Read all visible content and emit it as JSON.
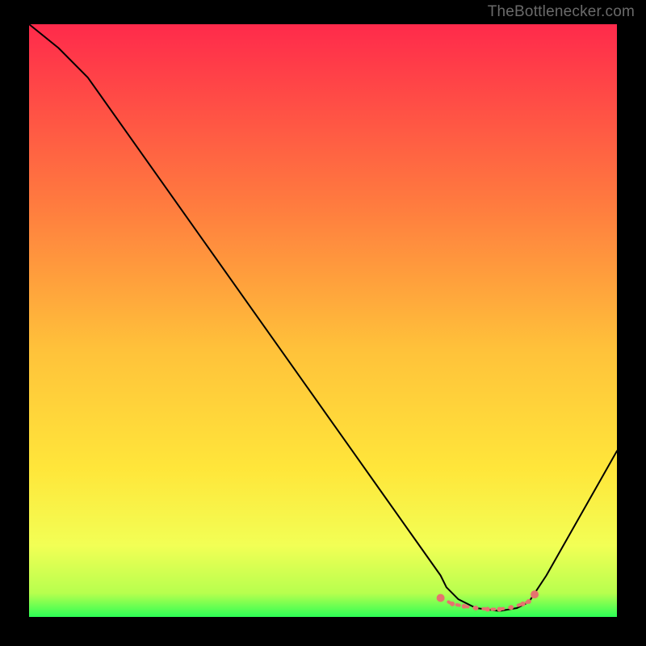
{
  "watermark": "TheBottlenecker.com",
  "chart_data": {
    "type": "line",
    "title": "",
    "xlabel": "",
    "ylabel": "",
    "xlim": [
      0,
      100
    ],
    "ylim": [
      0,
      100
    ],
    "series": [
      {
        "name": "bottleneck-curve",
        "x": [
          0,
          5,
          10,
          15,
          20,
          25,
          30,
          35,
          40,
          45,
          50,
          55,
          60,
          65,
          70,
          71,
          73,
          76,
          80,
          83,
          85,
          86,
          88,
          92,
          96,
          100
        ],
        "y": [
          100,
          96,
          91,
          84,
          77,
          70,
          63,
          56,
          49,
          42,
          35,
          28,
          21,
          14,
          7,
          5,
          3,
          1.5,
          1,
          1.5,
          2.5,
          4,
          7,
          14,
          21,
          28
        ]
      }
    ],
    "optimal_zone": {
      "name": "optimal-band-markers",
      "x": [
        70,
        72,
        74,
        76,
        78,
        80,
        82,
        84,
        85,
        86
      ],
      "y": [
        3.2,
        2.2,
        1.8,
        1.5,
        1.3,
        1.3,
        1.6,
        2.2,
        2.6,
        3.8
      ]
    },
    "background_gradient": [
      "#ff2a4b",
      "#ff9a3a",
      "#ffe63a",
      "#e8ff6a",
      "#2cff55"
    ],
    "frame_color": "#000000"
  }
}
